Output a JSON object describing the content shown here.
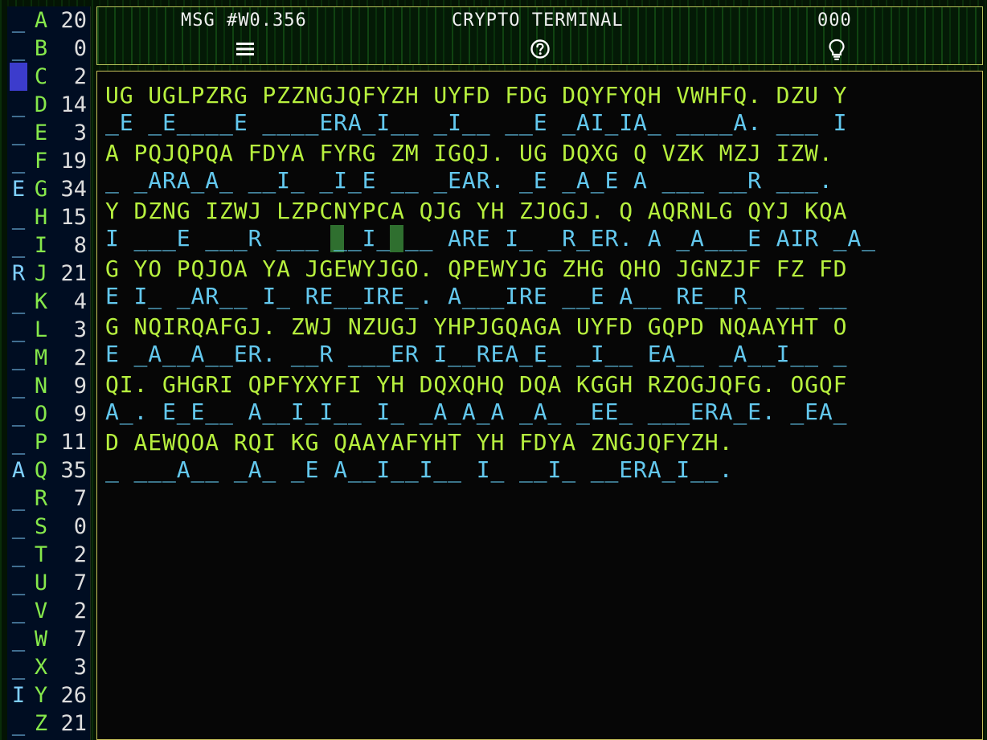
{
  "header": {
    "message_id": "MSG #W0.356",
    "title": "CRYPTO TERMINAL",
    "score": "000",
    "icons": [
      "menu-icon",
      "help-icon",
      "hint-icon"
    ]
  },
  "sidebar": {
    "rows": [
      {
        "sub": "_",
        "letter": "A",
        "count": "20"
      },
      {
        "sub": "_",
        "letter": "B",
        "count": "0"
      },
      {
        "sub": "_",
        "letter": "C",
        "count": "2",
        "selected": true
      },
      {
        "sub": "_",
        "letter": "D",
        "count": "14"
      },
      {
        "sub": "_",
        "letter": "E",
        "count": "3"
      },
      {
        "sub": "_",
        "letter": "F",
        "count": "19"
      },
      {
        "sub": "E",
        "letter": "G",
        "count": "34"
      },
      {
        "sub": "_",
        "letter": "H",
        "count": "15"
      },
      {
        "sub": "_",
        "letter": "I",
        "count": "8"
      },
      {
        "sub": "R",
        "letter": "J",
        "count": "21"
      },
      {
        "sub": "_",
        "letter": "K",
        "count": "4"
      },
      {
        "sub": "_",
        "letter": "L",
        "count": "3"
      },
      {
        "sub": "_",
        "letter": "M",
        "count": "2"
      },
      {
        "sub": "_",
        "letter": "N",
        "count": "9"
      },
      {
        "sub": "_",
        "letter": "O",
        "count": "9"
      },
      {
        "sub": "_",
        "letter": "P",
        "count": "11"
      },
      {
        "sub": "A",
        "letter": "Q",
        "count": "35"
      },
      {
        "sub": "_",
        "letter": "R",
        "count": "7"
      },
      {
        "sub": "_",
        "letter": "S",
        "count": "0"
      },
      {
        "sub": "_",
        "letter": "T",
        "count": "2"
      },
      {
        "sub": "_",
        "letter": "U",
        "count": "7"
      },
      {
        "sub": "_",
        "letter": "V",
        "count": "2"
      },
      {
        "sub": "_",
        "letter": "W",
        "count": "7"
      },
      {
        "sub": "_",
        "letter": "X",
        "count": "3"
      },
      {
        "sub": "I",
        "letter": "Y",
        "count": "26"
      },
      {
        "sub": "_",
        "letter": "Z",
        "count": "21"
      }
    ]
  },
  "puzzle": {
    "lines": [
      {
        "cipher": "UG UGLPZRG PZZNGJQFYZH UYFD FDG DQYFYQH VWHFQ. DZU Y",
        "plain": "_E _E____E ____ERA_I__ _I__ __E _AI_IA_ ____A. ___ I"
      },
      {
        "cipher": "A PQJQPQA FDYA FYRG ZM IGQJ. UG DQXG Q VZK MZJ IZW.",
        "plain": "_ _ARA_A_ __I_ _I_E __ _EAR. _E _A_E A ___ __R ___."
      },
      {
        "cipher": "Y DZNG IZWJ LZPCNYPCA QJG YH ZJOGJ. Q AQRNLG QYJ KQA",
        "plain": "I ___E ___R ___ __I_ __ ARE I_ _R_ER. A _A___E AIR _A_"
      },
      {
        "cipher": "G YO PQJOA YA JGEWYJGO. QPEWYJG ZHG QHO JGNZJF FZ FD",
        "plain": "E I_ _AR__ I_ RE__IRE_. A___IRE __E A__ RE__R_ __ __"
      },
      {
        "cipher": "G NQIRQAFGJ. ZWJ NZUGJ YHPJGQAGA UYFD GQPD NQAAYHT O",
        "plain": "E _A__A__ER. __R ___ER I__REA_E_ _I__ EA__ _A__I__ _"
      },
      {
        "cipher": "QI. GHGRI QPFYXYFI YH DQXQHQ DQA KGGH RZOGJQFG. OGQF",
        "plain": "A_. E_E__ A__I_I__ I_ _A_A_A _A_ _EE_ ___ERA_E. _EA_"
      },
      {
        "cipher": "D AEWQOA RQI KG QAAYAFYHT YH FDYA ZNGJQFYZH.",
        "plain": "_ ___A__ _A_ _E A__I__I__ I_ __I_ __ERA_I__."
      }
    ]
  }
}
